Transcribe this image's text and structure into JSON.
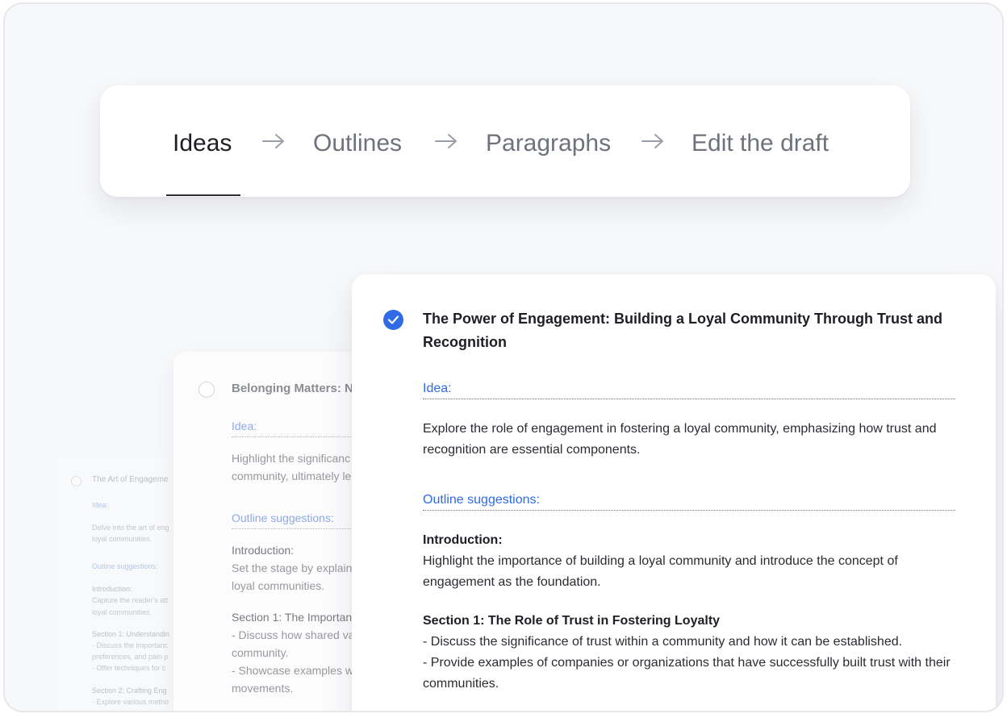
{
  "stepper": {
    "steps": [
      {
        "label": "Ideas",
        "active": true
      },
      {
        "label": "Outlines",
        "active": false
      },
      {
        "label": "Paragraphs",
        "active": false
      },
      {
        "label": "Edit the draft",
        "active": false
      }
    ]
  },
  "main_card": {
    "checked": true,
    "title": "The Power of Engagement: Building a Loyal Community Through Trust and Recognition",
    "idea_label": "Idea:",
    "idea_text": "Explore the role of engagement in fostering a loyal community, emphasizing how trust and recognition are essential components.",
    "outline_label": "Outline suggestions:",
    "intro_heading": "Introduction:",
    "intro_text": "Highlight the importance of building a loyal community and introduce the concept of engagement as the foundation.",
    "section1_heading": "Section 1: The Role of Trust in Fostering Loyalty",
    "section1_line1": "- Discuss the significance of trust within a community and how it can be established.",
    "section1_line2": "- Provide examples of companies or organizations that have successfully built trust with their communities."
  },
  "back_card_1": {
    "title": "Belonging Matters: N",
    "idea_label": "Idea:",
    "idea_line1": "Highlight the significanc",
    "idea_line2": "community, ultimately le",
    "outline_label": "Outline suggestions:",
    "intro_heading": "Introduction:",
    "intro_line1": "Set the stage by explain",
    "intro_line2": "loyal communities.",
    "section1_heading": "Section 1: The Importan",
    "section1_line1": "- Discuss how shared va",
    "section1_line2": "community.",
    "section1_line3": "- Showcase examples w",
    "section1_line4": "movements."
  },
  "back_card_2": {
    "title": "The Art of Engageme",
    "idea_label": "Idea:",
    "idea_line1": "Delve into the art of eng",
    "idea_line2": "loyal communities.",
    "outline_label": "Outline suggestions:",
    "intro_heading": "Introduction:",
    "intro_line1": "Capture the reader's att",
    "intro_line2": "loyal communities.",
    "section1_heading": "Section 1: Understandin",
    "section1_line1": "- Discuss the importanc",
    "section1_line2": "preferences, and pain p",
    "section1_line3": "- Offer techniques for c",
    "section2_heading": "Section 2: Crafting Eng",
    "section2_line1": "- Explore various metho"
  },
  "colors": {
    "accent": "#2f6be4",
    "text_dark": "#1d1f24",
    "text_muted": "#6e727a",
    "background": "#f7f8fa"
  }
}
